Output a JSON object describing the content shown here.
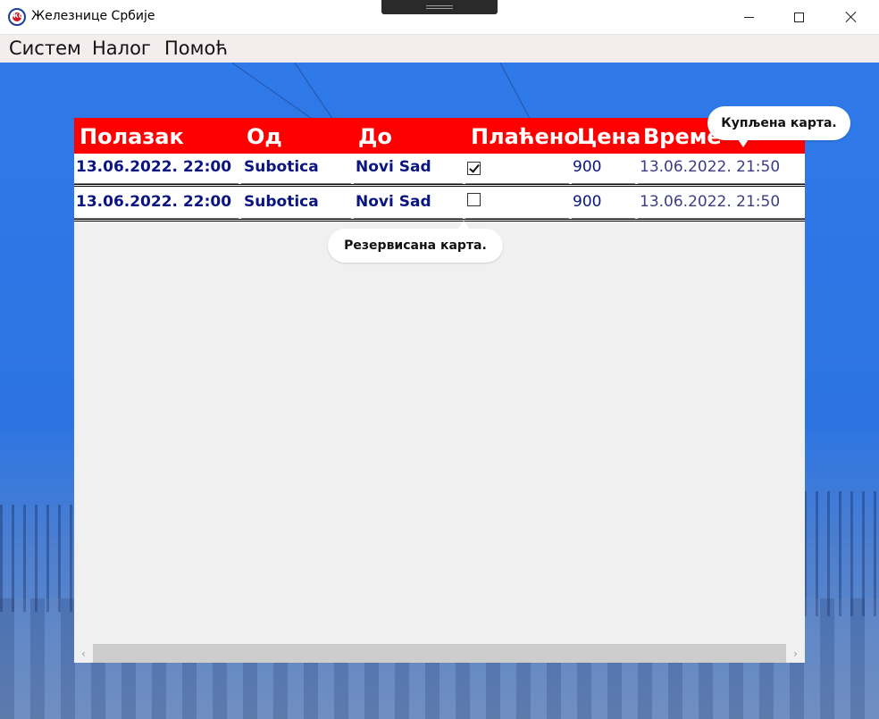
{
  "window": {
    "title": "Железнице Србије",
    "logo_icon": "zs-logo-icon"
  },
  "menu": {
    "items": [
      {
        "label": "Систем"
      },
      {
        "label": "Налог"
      },
      {
        "label": "Помоћ"
      }
    ]
  },
  "table": {
    "header_color": "#ff0000",
    "columns": [
      "Полазак",
      "Од",
      "До",
      "Плаћено",
      "Цена",
      "Време"
    ],
    "rows": [
      {
        "departure": "13.06.2022. 22:00",
        "from": "Subotica",
        "to": "Novi Sad",
        "paid": true,
        "price": "900",
        "time": "13.06.2022. 21:50"
      },
      {
        "departure": "13.06.2022. 22:00",
        "from": "Subotica",
        "to": "Novi Sad",
        "paid": false,
        "price": "900",
        "time": "13.06.2022. 21:50"
      }
    ]
  },
  "tooltips": {
    "purchased": "Купљена карта.",
    "reserved": "Резервисана карта."
  },
  "scrollbar": {
    "left_arrow": "‹",
    "right_arrow": "›"
  }
}
